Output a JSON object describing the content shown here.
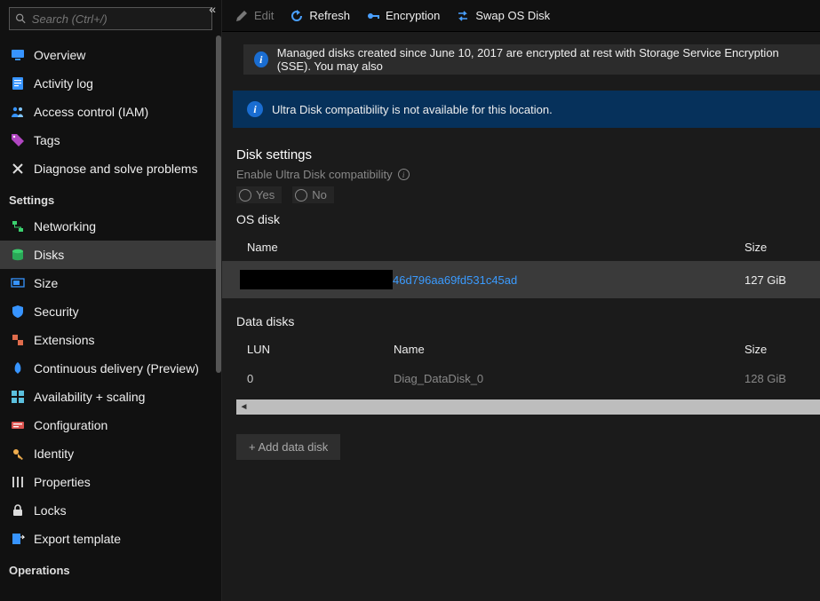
{
  "search": {
    "placeholder": "Search (Ctrl+/)"
  },
  "nav": {
    "top": [
      {
        "label": "Overview"
      },
      {
        "label": "Activity log"
      },
      {
        "label": "Access control (IAM)"
      },
      {
        "label": "Tags"
      },
      {
        "label": "Diagnose and solve problems"
      }
    ],
    "settings_header": "Settings",
    "settings": [
      {
        "label": "Networking"
      },
      {
        "label": "Disks"
      },
      {
        "label": "Size"
      },
      {
        "label": "Security"
      },
      {
        "label": "Extensions"
      },
      {
        "label": "Continuous delivery (Preview)"
      },
      {
        "label": "Availability + scaling"
      },
      {
        "label": "Configuration"
      },
      {
        "label": "Identity"
      },
      {
        "label": "Properties"
      },
      {
        "label": "Locks"
      },
      {
        "label": "Export template"
      }
    ],
    "operations_header": "Operations"
  },
  "toolbar": {
    "edit": "Edit",
    "refresh": "Refresh",
    "encryption": "Encryption",
    "swap": "Swap OS Disk"
  },
  "banner": "Managed disks created since June 10, 2017 are encrypted at rest with Storage Service Encryption (SSE). You may also",
  "alert": "Ultra Disk compatibility is not available for this location.",
  "disk_settings": {
    "title": "Disk settings",
    "ultra_label": "Enable Ultra Disk compatibility",
    "yes": "Yes",
    "no": "No"
  },
  "os_disk": {
    "title": "OS disk",
    "col_name": "Name",
    "col_size": "Size",
    "row": {
      "name_suffix": "46d796aa69fd531c45ad",
      "size": "127 GiB"
    }
  },
  "data_disks": {
    "title": "Data disks",
    "col_lun": "LUN",
    "col_name": "Name",
    "col_size": "Size",
    "row": {
      "lun": "0",
      "name": "Diag_DataDisk_0",
      "size": "128 GiB"
    }
  },
  "add_btn": "+ Add data disk"
}
